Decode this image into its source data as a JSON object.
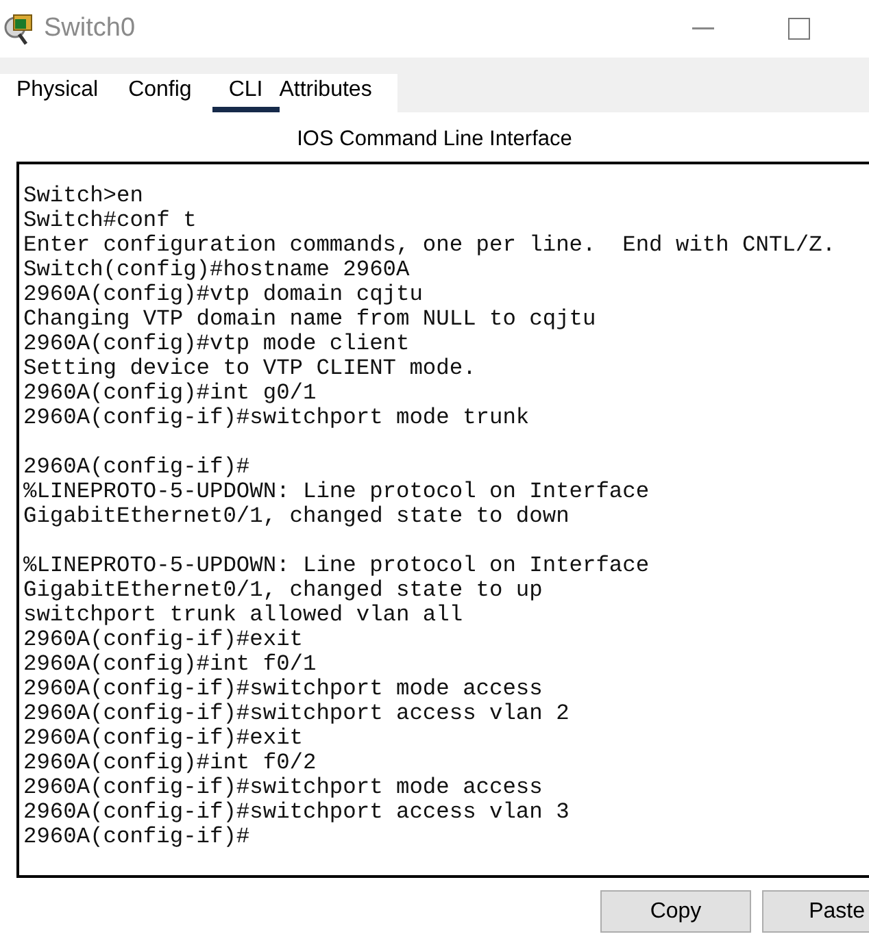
{
  "window": {
    "title": "Switch0"
  },
  "tabs": [
    {
      "label": "Physical",
      "selected": false
    },
    {
      "label": "Config",
      "selected": false
    },
    {
      "label": "CLI",
      "selected": true
    },
    {
      "label": "Attributes",
      "selected": false
    }
  ],
  "panel_title": "IOS Command Line Interface",
  "terminal": {
    "blocks": [
      [
        "Switch>en",
        "Switch#conf t",
        "Enter configuration commands, one per line.  End with CNTL/Z.",
        "Switch(config)#hostname 2960A",
        "2960A(config)#vtp domain cqjtu",
        "Changing VTP domain name from NULL to cqjtu",
        "2960A(config)#vtp mode client",
        "Setting device to VTP CLIENT mode.",
        "2960A(config)#int g0/1",
        "2960A(config-if)#switchport mode trunk"
      ],
      [
        "2960A(config-if)#",
        "%LINEPROTO-5-UPDOWN: Line protocol on Interface",
        "GigabitEthernet0/1, changed state to down"
      ],
      [
        "%LINEPROTO-5-UPDOWN: Line protocol on Interface",
        "GigabitEthernet0/1, changed state to up",
        "switchport trunk allowed vlan all",
        "2960A(config-if)#exit",
        "2960A(config)#int f0/1",
        "2960A(config-if)#switchport mode access",
        "2960A(config-if)#switchport access vlan 2",
        "2960A(config-if)#exit",
        "2960A(config)#int f0/2",
        "2960A(config-if)#switchport mode access",
        "2960A(config-if)#switchport access vlan 3",
        "2960A(config-if)#"
      ]
    ]
  },
  "buttons": [
    {
      "label": "Copy"
    },
    {
      "label": "Paste"
    }
  ]
}
